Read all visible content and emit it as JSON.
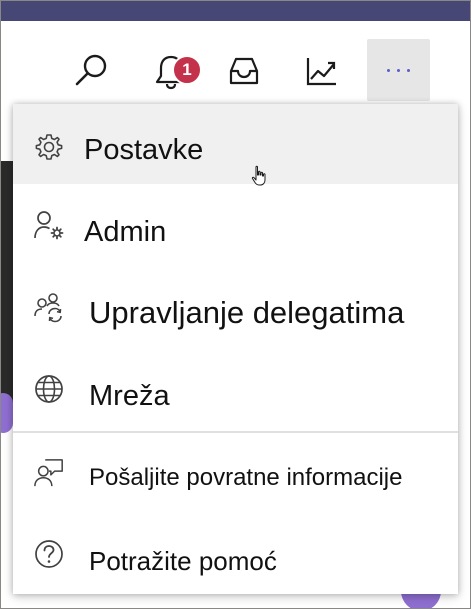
{
  "toolbar": {
    "notification_count": "1",
    "buttons": [
      {
        "name": "search",
        "icon": "search-icon"
      },
      {
        "name": "notifications",
        "icon": "bell-icon"
      },
      {
        "name": "inbox",
        "icon": "inbox-icon"
      },
      {
        "name": "analytics",
        "icon": "trend-chart-icon"
      },
      {
        "name": "more",
        "icon": "more-dots-icon"
      }
    ]
  },
  "menu": {
    "items": [
      {
        "label": "Postavke",
        "icon": "gear-icon"
      },
      {
        "label": "Admin",
        "icon": "person-gear-icon"
      },
      {
        "label": "Upravljanje delegatima",
        "icon": "people-sync-icon"
      },
      {
        "label": "Mreža",
        "icon": "globe-icon"
      },
      {
        "label": "Pošaljite povratne informacije",
        "icon": "person-feedback-icon"
      },
      {
        "label": "Potražite pomoć",
        "icon": "question-circle-icon"
      }
    ]
  },
  "colors": {
    "accent": "#464775",
    "badge": "#c4314b",
    "hover": "#f0f0f0",
    "icon": "#424242",
    "more_dots": "#5b5fc7"
  }
}
